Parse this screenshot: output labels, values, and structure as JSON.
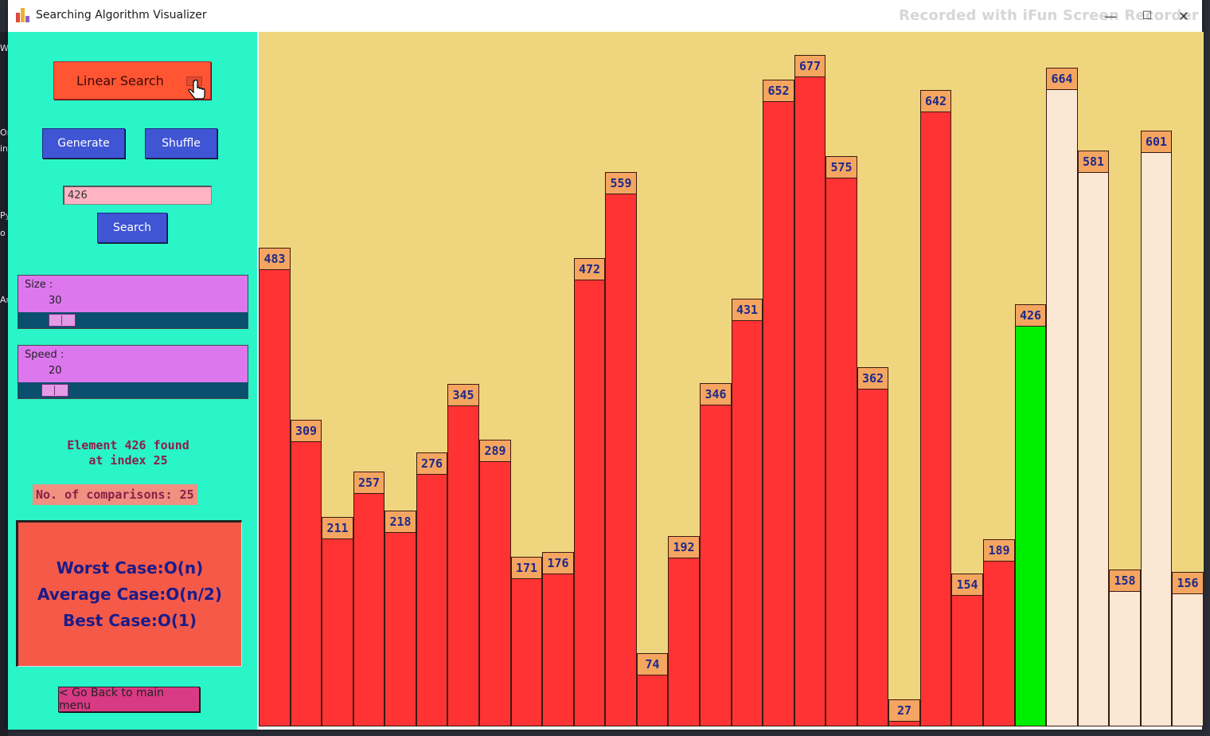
{
  "window": {
    "title": "Searching Algorithm Visualizer",
    "watermark": "Recorded with iFun Screen Recorder",
    "controls": {
      "minimize": "—",
      "maximize": "☐",
      "close": "✕"
    }
  },
  "desktop_edge_letters": [
    "W",
    "Or",
    "in",
    "Py",
    "o",
    "Ar"
  ],
  "sidebar": {
    "algorithm_label": "Linear Search",
    "generate_label": "Generate",
    "shuffle_label": "Shuffle",
    "search_value": "426",
    "search_label": "Search",
    "size_slider": {
      "label": "Size :",
      "value": "30",
      "fraction": 0.07
    },
    "speed_slider": {
      "label": "Speed :",
      "value": "20",
      "fraction": 0.03
    },
    "result_line1": "Element 426 found",
    "result_line2": "at index 25",
    "comparisons": "No. of comparisons: 25",
    "complexity": {
      "worst": "Worst Case:O(n)",
      "average": "Average Case:O(n/2)",
      "best": "Best Case:O(1)"
    },
    "back_label": "< Go Back to main menu"
  },
  "colors": {
    "sidebar_bg": "#2af5c9",
    "canvas_bg": "#efd67e",
    "bar_checked": "#ff3333",
    "bar_found": "#00ee00",
    "bar_unchecked": "#fae8d4",
    "label_bg": "#f4a560"
  },
  "chart_data": {
    "type": "bar",
    "values": [
      483,
      309,
      211,
      257,
      218,
      276,
      345,
      289,
      171,
      176,
      472,
      559,
      74,
      192,
      346,
      431,
      652,
      677,
      575,
      362,
      27,
      642,
      154,
      189,
      426,
      664,
      581,
      158,
      601,
      156
    ],
    "states": [
      "checked",
      "checked",
      "checked",
      "checked",
      "checked",
      "checked",
      "checked",
      "checked",
      "checked",
      "checked",
      "checked",
      "checked",
      "checked",
      "checked",
      "checked",
      "checked",
      "checked",
      "checked",
      "checked",
      "checked",
      "checked",
      "checked",
      "checked",
      "checked",
      "found",
      "unchecked",
      "unchecked",
      "unchecked",
      "unchecked",
      "unchecked"
    ],
    "found_index": 24
  }
}
